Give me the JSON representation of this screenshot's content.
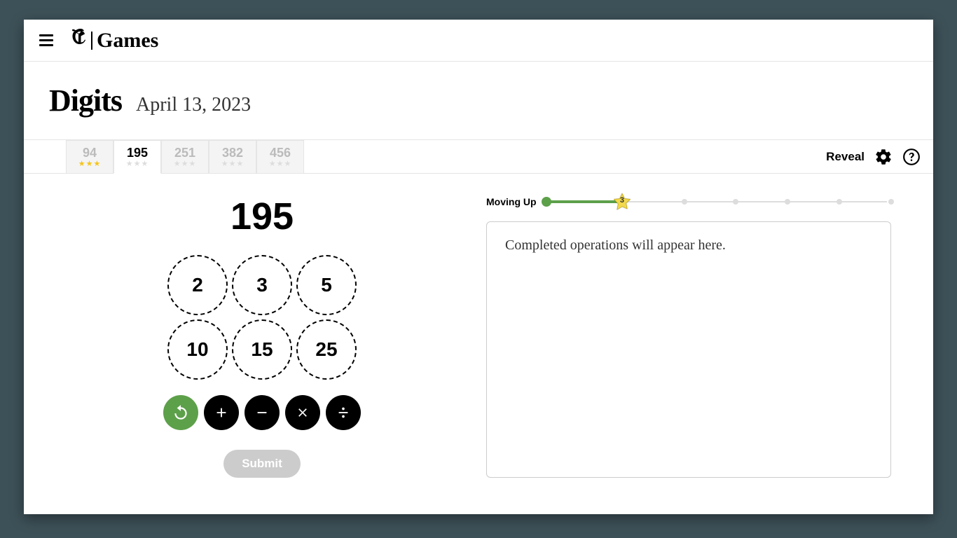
{
  "header": {
    "brand_games": "Games"
  },
  "title": {
    "name": "Digits",
    "date": "April 13, 2023"
  },
  "tabs": [
    {
      "number": "94",
      "stars": 3,
      "active": false,
      "completed": true
    },
    {
      "number": "195",
      "stars": 0,
      "active": true,
      "completed": false
    },
    {
      "number": "251",
      "stars": 0,
      "active": false,
      "completed": false
    },
    {
      "number": "382",
      "stars": 0,
      "active": false,
      "completed": false
    },
    {
      "number": "456",
      "stars": 0,
      "active": false,
      "completed": false
    }
  ],
  "toolbar": {
    "reveal": "Reveal"
  },
  "game": {
    "target": "195",
    "numbers": [
      "2",
      "3",
      "5",
      "10",
      "15",
      "25"
    ],
    "submit": "Submit"
  },
  "progress": {
    "label": "Moving Up",
    "star_value": "3",
    "star_pos_pct": 22,
    "dots_pct": [
      0,
      40,
      55,
      70,
      85,
      100
    ]
  },
  "panel": {
    "placeholder": "Completed operations will appear here."
  }
}
